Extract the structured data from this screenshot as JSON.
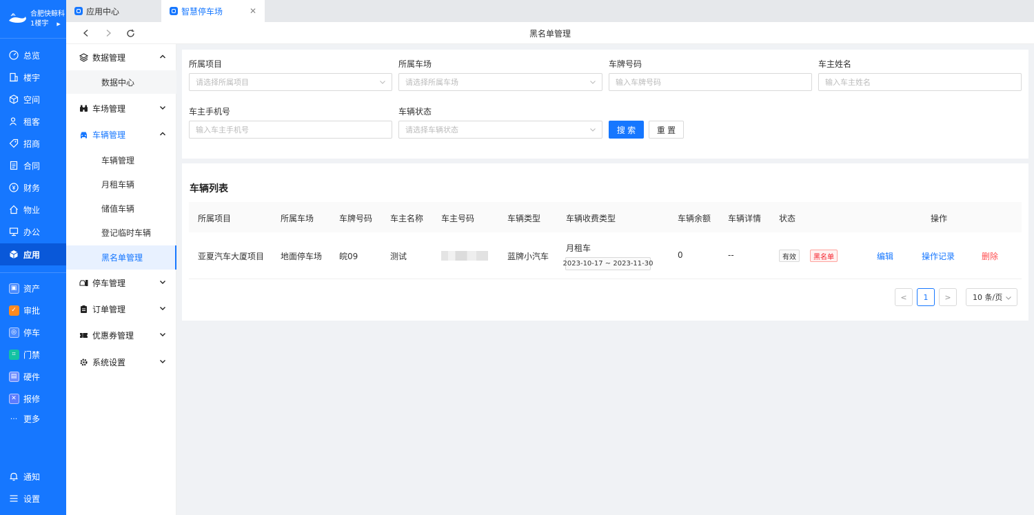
{
  "rail": {
    "brand_title": "合肥快鲸科",
    "brand_sub": "1楼宇",
    "items": [
      {
        "label": "总览",
        "icon": "dashboard-icon"
      },
      {
        "label": "楼宇",
        "icon": "building-icon"
      },
      {
        "label": "空间",
        "icon": "cube-icon"
      },
      {
        "label": "租客",
        "icon": "users-icon"
      },
      {
        "label": "招商",
        "icon": "tag-icon"
      },
      {
        "label": "合同",
        "icon": "document-icon"
      },
      {
        "label": "财务",
        "icon": "coin-icon"
      },
      {
        "label": "物业",
        "icon": "home-icon"
      },
      {
        "label": "办公",
        "icon": "monitor-icon"
      },
      {
        "label": "应用",
        "icon": "app-cube-icon"
      }
    ],
    "apps": [
      {
        "label": "资产",
        "icon": "asset-icon",
        "color": "#4a8bff"
      },
      {
        "label": "审批",
        "icon": "approval-icon",
        "color": "#ff8a1f"
      },
      {
        "label": "停车",
        "icon": "parking-icon",
        "color": "#4a8bff"
      },
      {
        "label": "门禁",
        "icon": "access-icon",
        "color": "#13c2a3"
      },
      {
        "label": "硬件",
        "icon": "hardware-icon",
        "color": "#6c8cff"
      },
      {
        "label": "报修",
        "icon": "repair-icon",
        "color": "#5b7cff"
      }
    ],
    "more": "更多",
    "notify": "通知",
    "settings": "设置"
  },
  "tabs": [
    {
      "label": "应用中心"
    },
    {
      "label": "智慧停车场"
    }
  ],
  "page_title": "黑名单管理",
  "sidebar": {
    "groups": {
      "data": "数据管理",
      "lot": "车场管理",
      "vehicle": "车辆管理",
      "parking": "停车管理",
      "order": "订单管理",
      "coupon": "优惠券管理",
      "system": "系统设置"
    },
    "subs": {
      "data_center": "数据中心",
      "vehicle_mgmt": "车辆管理",
      "monthly": "月租车辆",
      "stored": "储值车辆",
      "temp": "登记临时车辆",
      "blacklist": "黑名单管理"
    }
  },
  "filters": {
    "project": {
      "label": "所属项目",
      "placeholder": "请选择所属项目"
    },
    "lot": {
      "label": "所属车场",
      "placeholder": "请选择所属车场"
    },
    "plate": {
      "label": "车牌号码",
      "placeholder": "输入车牌号码"
    },
    "owner": {
      "label": "车主姓名",
      "placeholder": "输入车主姓名"
    },
    "phone": {
      "label": "车主手机号",
      "placeholder": "输入车主手机号"
    },
    "status": {
      "label": "车辆状态",
      "placeholder": "请选择车辆状态"
    },
    "search": "搜 索",
    "reset": "重 置"
  },
  "list": {
    "title": "车辆列表",
    "columns": [
      "所属项目",
      "所属车场",
      "车牌号码",
      "车主名称",
      "车主号码",
      "车辆类型",
      "车辆收费类型",
      "车辆余额",
      "车辆详情",
      "状态",
      "操作"
    ],
    "rows": [
      {
        "project": "亚夏汽车大厦项目",
        "lot": "地面停车场",
        "plate": "皖09",
        "owner": "测试",
        "phone": "",
        "type": "蓝牌小汽车",
        "fee_type": "月租车",
        "date_range": "2023-10-17 ~ 2023-11-30",
        "balance": "0",
        "detail": "--",
        "status_tags": [
          "有效",
          "黑名单"
        ],
        "actions": [
          "编辑",
          "操作记录",
          "删除"
        ]
      }
    ]
  },
  "pagination": {
    "prev": "<",
    "page": "1",
    "next": ">",
    "page_size": "10 条/页"
  }
}
